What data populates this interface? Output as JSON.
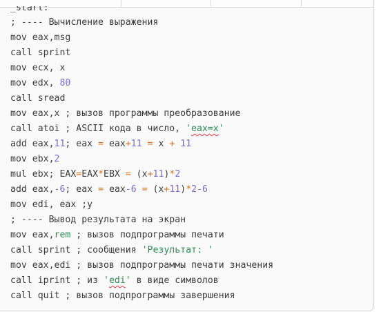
{
  "editor": {
    "lines": [
      {
        "parts": [
          {
            "t": "_start:",
            "c": "plain"
          }
        ]
      },
      {
        "parts": [
          {
            "t": "; ---- Вычисление выражения",
            "c": "comment"
          }
        ]
      },
      {
        "parts": [
          {
            "t": "mov eax,msg",
            "c": "plain"
          }
        ]
      },
      {
        "parts": [
          {
            "t": "call sprint",
            "c": "plain"
          }
        ]
      },
      {
        "parts": [
          {
            "t": "mov ecx, x",
            "c": "plain"
          }
        ]
      },
      {
        "parts": [
          {
            "t": "mov edx, ",
            "c": "plain"
          },
          {
            "t": "80",
            "c": "num"
          }
        ]
      },
      {
        "parts": [
          {
            "t": "call sread",
            "c": "plain"
          }
        ]
      },
      {
        "parts": [
          {
            "t": "mov eax,x ; вызов программы преобразование",
            "c": "plain"
          }
        ]
      },
      {
        "parts": [
          {
            "t": "call atoi ; ASCII кода в число, ",
            "c": "plain"
          },
          {
            "t": "'",
            "c": "str"
          },
          {
            "t": "eax=x",
            "c": "str squiggle"
          },
          {
            "t": "'",
            "c": "str"
          }
        ]
      },
      {
        "parts": [
          {
            "t": "add eax,",
            "c": "plain"
          },
          {
            "t": "11",
            "c": "num"
          },
          {
            "t": "; eax ",
            "c": "plain"
          },
          {
            "t": "=",
            "c": "op"
          },
          {
            "t": " eax",
            "c": "plain"
          },
          {
            "t": "+",
            "c": "op"
          },
          {
            "t": "11",
            "c": "num"
          },
          {
            "t": " ",
            "c": "plain"
          },
          {
            "t": "=",
            "c": "op"
          },
          {
            "t": " x ",
            "c": "plain"
          },
          {
            "t": "+",
            "c": "op"
          },
          {
            "t": " ",
            "c": "plain"
          },
          {
            "t": "11",
            "c": "num"
          }
        ]
      },
      {
        "parts": [
          {
            "t": "mov ebx,",
            "c": "plain"
          },
          {
            "t": "2",
            "c": "num"
          }
        ]
      },
      {
        "parts": [
          {
            "t": "mul ebx; EAX",
            "c": "plain"
          },
          {
            "t": "=",
            "c": "op"
          },
          {
            "t": "EAX",
            "c": "plain"
          },
          {
            "t": "*",
            "c": "op"
          },
          {
            "t": "EBX ",
            "c": "plain"
          },
          {
            "t": "=",
            "c": "op"
          },
          {
            "t": " (x",
            "c": "plain"
          },
          {
            "t": "+",
            "c": "op"
          },
          {
            "t": "11",
            "c": "num"
          },
          {
            "t": ")",
            "c": "plain"
          },
          {
            "t": "*",
            "c": "op"
          },
          {
            "t": "2",
            "c": "num"
          }
        ]
      },
      {
        "parts": [
          {
            "t": "add eax,",
            "c": "plain"
          },
          {
            "t": "-6",
            "c": "num"
          },
          {
            "t": "; eax ",
            "c": "plain"
          },
          {
            "t": "=",
            "c": "op"
          },
          {
            "t": " eax",
            "c": "plain"
          },
          {
            "t": "-6",
            "c": "num"
          },
          {
            "t": " ",
            "c": "plain"
          },
          {
            "t": "=",
            "c": "op"
          },
          {
            "t": " (x",
            "c": "plain"
          },
          {
            "t": "+",
            "c": "op"
          },
          {
            "t": "11",
            "c": "num"
          },
          {
            "t": ")",
            "c": "plain"
          },
          {
            "t": "*",
            "c": "op"
          },
          {
            "t": "2",
            "c": "num"
          },
          {
            "t": "-6",
            "c": "num"
          }
        ]
      },
      {
        "parts": [
          {
            "t": "mov edi, eax ;y",
            "c": "plain"
          }
        ]
      },
      {
        "parts": [
          {
            "t": "; ---- Вывод результата на экран",
            "c": "comment"
          }
        ]
      },
      {
        "parts": [
          {
            "t": "mov eax,",
            "c": "plain"
          },
          {
            "t": "rem",
            "c": "hl"
          },
          {
            "t": " ; вызов подпрограммы печати",
            "c": "plain"
          }
        ]
      },
      {
        "parts": [
          {
            "t": "call sprint ; сообщения ",
            "c": "plain"
          },
          {
            "t": "'Результат: '",
            "c": "str"
          }
        ]
      },
      {
        "parts": [
          {
            "t": "mov eax,edi ; вызов подпрограммы печати значения",
            "c": "plain"
          }
        ]
      },
      {
        "parts": [
          {
            "t": "call iprint ; из ",
            "c": "plain"
          },
          {
            "t": "'",
            "c": "str"
          },
          {
            "t": "edi",
            "c": "str squiggle"
          },
          {
            "t": "'",
            "c": "str"
          },
          {
            "t": " в виде символов",
            "c": "plain"
          }
        ]
      },
      {
        "parts": [
          {
            "t": "call quit ; вызов подпрограммы завершения",
            "c": "plain"
          }
        ]
      }
    ]
  },
  "colors": {
    "text": "#3b3b3b",
    "number": "#7b6bc9",
    "operator": "#d96c1f",
    "string": "#2e8b57",
    "spellcheck": "#e0383e"
  }
}
